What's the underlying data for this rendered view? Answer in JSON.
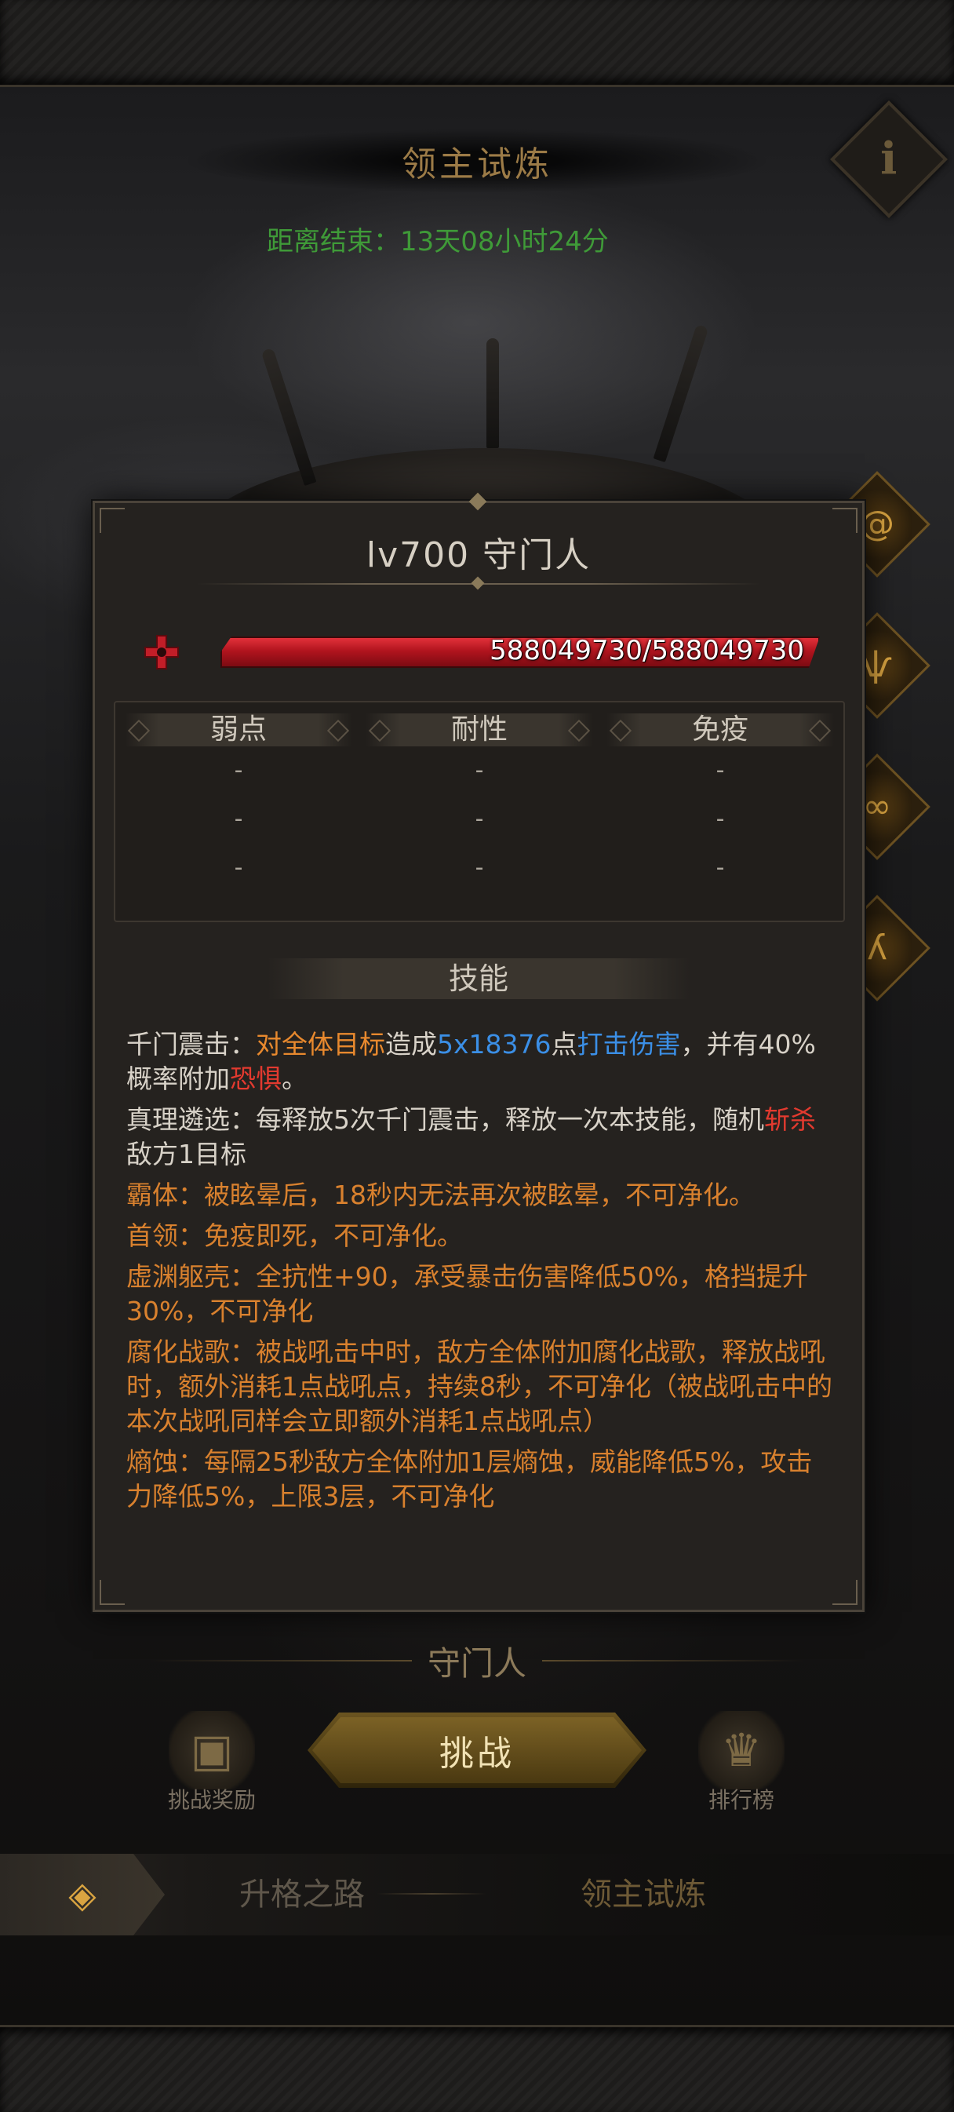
{
  "header": {
    "title": "领主试炼",
    "countdown": "距离结束：13天08小时24分",
    "info_glyph": "i"
  },
  "side_icons": [
    "swirl-icon",
    "beast-icon",
    "chain-icon",
    "wolf-icon"
  ],
  "boss": {
    "level_name": "lv700  守门人",
    "hp_text": "588049730/588049730",
    "hp_fraction": 1.0,
    "hp_color": "#d3202a"
  },
  "resistances": {
    "columns": [
      {
        "label": "弱点",
        "values": [
          "-",
          "-",
          "-"
        ]
      },
      {
        "label": "耐性",
        "values": [
          "-",
          "-",
          "-"
        ]
      },
      {
        "label": "免疫",
        "values": [
          "-",
          "-",
          "-"
        ]
      }
    ]
  },
  "skills": {
    "header": "技能",
    "items": [
      {
        "segments": [
          {
            "t": "千门震击：",
            "c": "w"
          },
          {
            "t": "对全体目标",
            "c": "o"
          },
          {
            "t": "造成",
            "c": "w"
          },
          {
            "t": "5x18376",
            "c": "b"
          },
          {
            "t": "点",
            "c": "w"
          },
          {
            "t": "打击伤害",
            "c": "b"
          },
          {
            "t": "，并有40%概率附加",
            "c": "w"
          },
          {
            "t": "恐惧",
            "c": "r"
          },
          {
            "t": "。",
            "c": "w"
          }
        ]
      },
      {
        "segments": [
          {
            "t": "真理遴选：每释放5次千门震击，释放一次本技能，随机",
            "c": "w"
          },
          {
            "t": "斩杀",
            "c": "r"
          },
          {
            "t": "敌方1目标",
            "c": "w"
          }
        ]
      },
      {
        "segments": [
          {
            "t": "霸体：被眩晕后，18秒内无法再次被眩晕，不可净化。",
            "c": "org"
          }
        ]
      },
      {
        "segments": [
          {
            "t": "首领：免疫即死，不可净化。",
            "c": "org"
          }
        ]
      },
      {
        "segments": [
          {
            "t": "虚渊躯壳：全抗性+90，承受暴击伤害降低50%，格挡提升30%，不可净化",
            "c": "org"
          }
        ]
      },
      {
        "segments": [
          {
            "t": "腐化战歌：被战吼击中时，敌方全体附加腐化战歌，释放战吼时，额外消耗1点战吼点，持续8秒，不可净化（被战吼击中的本次战吼同样会立即额外消耗1点战吼点）",
            "c": "org"
          }
        ]
      },
      {
        "segments": [
          {
            "t": "熵蚀：每隔25秒敌方全体附加1层熵蚀，威能降低5%，攻击力降低5%，上限3层，不可净化",
            "c": "org"
          }
        ]
      }
    ]
  },
  "below": {
    "boss_subtitle": "守门人",
    "challenge_label": "挑战",
    "reward_label": "挑战奖励",
    "ranking_label": "排行榜"
  },
  "tabs": {
    "items": [
      "升格之路",
      "领主试炼"
    ],
    "active": "领主试炼"
  }
}
